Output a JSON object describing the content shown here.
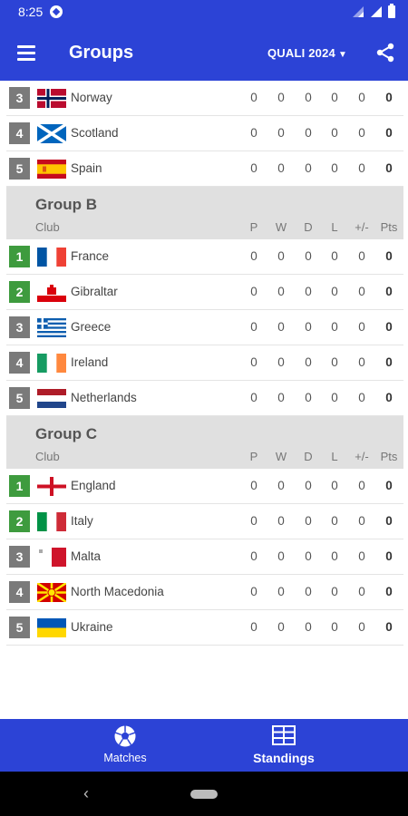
{
  "status_bar": {
    "time": "8:25"
  },
  "app_bar": {
    "title": "Groups",
    "competition": "QUALI 2024"
  },
  "stat_headers": {
    "club": "Club",
    "p": "P",
    "w": "W",
    "d": "D",
    "l": "L",
    "gd": "+/-",
    "pts": "Pts"
  },
  "colors": {
    "primary": "#2c43d6",
    "qualify_green": "#3e9b3e",
    "position_gray": "#7a7a7a"
  },
  "group_a_tail": [
    {
      "pos": "3",
      "team": "Norway",
      "flag": "norway",
      "status": "gray",
      "p": "0",
      "w": "0",
      "d": "0",
      "l": "0",
      "gd": "0",
      "pts": "0"
    },
    {
      "pos": "4",
      "team": "Scotland",
      "flag": "scotland",
      "status": "gray",
      "p": "0",
      "w": "0",
      "d": "0",
      "l": "0",
      "gd": "0",
      "pts": "0"
    },
    {
      "pos": "5",
      "team": "Spain",
      "flag": "spain",
      "status": "gray",
      "p": "0",
      "w": "0",
      "d": "0",
      "l": "0",
      "gd": "0",
      "pts": "0"
    }
  ],
  "group_b": {
    "title": "Group B",
    "teams": [
      {
        "pos": "1",
        "team": "France",
        "flag": "france",
        "status": "green",
        "p": "0",
        "w": "0",
        "d": "0",
        "l": "0",
        "gd": "0",
        "pts": "0"
      },
      {
        "pos": "2",
        "team": "Gibraltar",
        "flag": "gibraltar",
        "status": "green",
        "p": "0",
        "w": "0",
        "d": "0",
        "l": "0",
        "gd": "0",
        "pts": "0"
      },
      {
        "pos": "3",
        "team": "Greece",
        "flag": "greece",
        "status": "gray",
        "p": "0",
        "w": "0",
        "d": "0",
        "l": "0",
        "gd": "0",
        "pts": "0"
      },
      {
        "pos": "4",
        "team": "Ireland",
        "flag": "ireland",
        "status": "gray",
        "p": "0",
        "w": "0",
        "d": "0",
        "l": "0",
        "gd": "0",
        "pts": "0"
      },
      {
        "pos": "5",
        "team": "Netherlands",
        "flag": "netherlands",
        "status": "gray",
        "p": "0",
        "w": "0",
        "d": "0",
        "l": "0",
        "gd": "0",
        "pts": "0"
      }
    ]
  },
  "group_c": {
    "title": "Group C",
    "teams": [
      {
        "pos": "1",
        "team": "England",
        "flag": "england",
        "status": "green",
        "p": "0",
        "w": "0",
        "d": "0",
        "l": "0",
        "gd": "0",
        "pts": "0"
      },
      {
        "pos": "2",
        "team": "Italy",
        "flag": "italy",
        "status": "green",
        "p": "0",
        "w": "0",
        "d": "0",
        "l": "0",
        "gd": "0",
        "pts": "0"
      },
      {
        "pos": "3",
        "team": "Malta",
        "flag": "malta",
        "status": "gray",
        "p": "0",
        "w": "0",
        "d": "0",
        "l": "0",
        "gd": "0",
        "pts": "0"
      },
      {
        "pos": "4",
        "team": "North Macedonia",
        "flag": "north-macedonia",
        "status": "gray",
        "p": "0",
        "w": "0",
        "d": "0",
        "l": "0",
        "gd": "0",
        "pts": "0"
      },
      {
        "pos": "5",
        "team": "Ukraine",
        "flag": "ukraine",
        "status": "gray",
        "p": "0",
        "w": "0",
        "d": "0",
        "l": "0",
        "gd": "0",
        "pts": "0"
      }
    ]
  },
  "bottom_nav": [
    {
      "label": "Matches",
      "icon": "soccer-ball-icon"
    },
    {
      "label": "Standings",
      "icon": "table-icon"
    }
  ]
}
